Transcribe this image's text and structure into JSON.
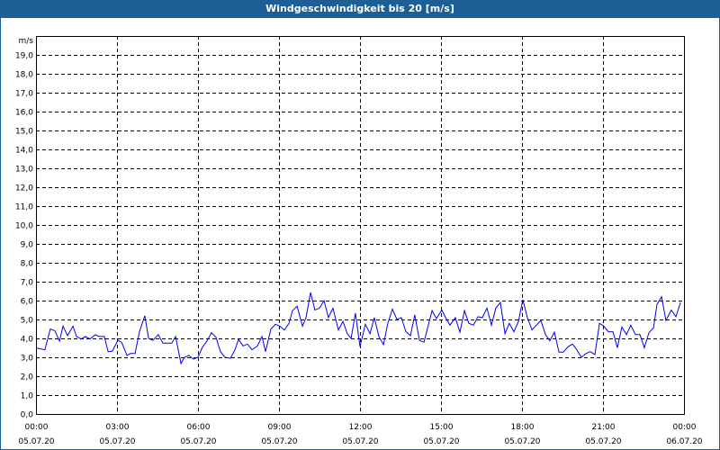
{
  "chart_data": {
    "type": "line",
    "title": "Windgeschwindigkeit bis 20 [m/s]",
    "ylabel": "m/s",
    "xlabel": "",
    "ylim": [
      0,
      20
    ],
    "xlim_hours": [
      0,
      24
    ],
    "grid": true,
    "y_ticks": [
      "0,0",
      "1,0",
      "2,0",
      "3,0",
      "4,0",
      "5,0",
      "6,0",
      "7,0",
      "8,0",
      "9,0",
      "10,0",
      "11,0",
      "12,0",
      "13,0",
      "14,0",
      "15,0",
      "16,0",
      "17,0",
      "18,0",
      "19,0"
    ],
    "x_ticks": [
      {
        "time": "00:00",
        "date": "05.07.20"
      },
      {
        "time": "03:00",
        "date": "05.07.20"
      },
      {
        "time": "06:00",
        "date": "05.07.20"
      },
      {
        "time": "09:00",
        "date": "05.07.20"
      },
      {
        "time": "12:00",
        "date": "05.07.20"
      },
      {
        "time": "15:00",
        "date": "05.07.20"
      },
      {
        "time": "18:00",
        "date": "05.07.20"
      },
      {
        "time": "21:00",
        "date": "05.07.20"
      },
      {
        "time": "00:00",
        "date": "06.07.20"
      }
    ],
    "series": [
      {
        "name": "Windgeschwindigkeit",
        "color": "#0000ee",
        "x_hours": [
          0,
          0.17,
          0.33,
          0.53,
          0.7,
          0.87,
          1,
          1.17,
          1.37,
          1.5,
          1.67,
          1.83,
          2,
          2.2,
          2.33,
          2.53,
          2.67,
          2.83,
          3.03,
          3.17,
          3.37,
          3.5,
          3.67,
          3.83,
          4.03,
          4.17,
          4.33,
          4.53,
          4.7,
          4.87,
          5.03,
          5.17,
          5.37,
          5.5,
          5.67,
          5.83,
          6,
          6.17,
          6.33,
          6.5,
          6.67,
          6.83,
          7,
          7.2,
          7.37,
          7.5,
          7.67,
          7.83,
          8,
          8.2,
          8.37,
          8.5,
          8.7,
          8.87,
          9.03,
          9.2,
          9.37,
          9.5,
          9.67,
          9.87,
          10,
          10.17,
          10.33,
          10.5,
          10.67,
          10.83,
          11,
          11.2,
          11.37,
          11.53,
          11.67,
          11.83,
          12,
          12.2,
          12.37,
          12.53,
          12.7,
          12.87,
          13.03,
          13.2,
          13.37,
          13.53,
          13.7,
          13.87,
          14.03,
          14.2,
          14.37,
          14.53,
          14.67,
          14.83,
          15.03,
          15.17,
          15.33,
          15.53,
          15.7,
          15.87,
          16.03,
          16.2,
          16.37,
          16.53,
          16.7,
          16.87,
          17.03,
          17.2,
          17.37,
          17.53,
          17.7,
          17.87,
          18.03,
          18.2,
          18.37,
          18.53,
          18.7,
          18.87,
          19.03,
          19.2,
          19.37,
          19.53,
          19.7,
          19.87,
          20.03,
          20.2,
          20.37,
          20.53,
          20.7,
          20.87,
          21.03,
          21.2,
          21.37,
          21.53,
          21.7,
          21.87,
          22.03,
          22.2,
          22.37,
          22.53,
          22.7,
          22.87,
          23,
          23.17,
          23.33,
          23.53,
          23.7,
          23.87
        ],
        "values": [
          3.5,
          3.45,
          3.4,
          4.5,
          4.4,
          3.85,
          4.65,
          4.15,
          4.65,
          4.1,
          3.97,
          4.1,
          3.97,
          4.2,
          4.1,
          4.1,
          3.3,
          3.33,
          3.9,
          3.8,
          3.1,
          3.2,
          3.2,
          4.35,
          5.2,
          4.0,
          3.9,
          4.2,
          3.75,
          3.75,
          3.75,
          4.1,
          2.67,
          3.0,
          3.1,
          2.9,
          3.0,
          3.55,
          3.85,
          4.3,
          4.05,
          3.3,
          3.0,
          2.95,
          3.4,
          3.95,
          3.6,
          3.7,
          3.4,
          3.6,
          4.1,
          3.3,
          4.5,
          4.75,
          4.65,
          4.45,
          4.8,
          5.47,
          5.7,
          4.65,
          5.1,
          6.43,
          5.5,
          5.6,
          6.0,
          5.1,
          5.6,
          4.45,
          4.9,
          4.25,
          4.0,
          5.33,
          3.57,
          4.75,
          4.25,
          5.1,
          4.1,
          3.67,
          4.8,
          5.55,
          5.0,
          5.1,
          4.35,
          4.15,
          5.25,
          3.9,
          3.8,
          4.7,
          5.47,
          5.05,
          5.5,
          5.1,
          4.7,
          5.1,
          4.33,
          5.47,
          4.8,
          4.7,
          5.15,
          5.1,
          5.6,
          4.7,
          5.6,
          5.9,
          4.25,
          4.8,
          4.35,
          4.9,
          6.05,
          5.1,
          4.45,
          4.7,
          4.95,
          4.2,
          3.87,
          4.33,
          3.27,
          3.27,
          3.55,
          3.7,
          3.4,
          3.0,
          3.2,
          3.3,
          3.15,
          4.8,
          4.65,
          4.35,
          4.35,
          3.5,
          4.6,
          4.2,
          4.7,
          4.2,
          4.2,
          3.5,
          4.3,
          4.55,
          5.8,
          6.2,
          4.95,
          5.5,
          5.15,
          5.9
        ]
      }
    ]
  }
}
